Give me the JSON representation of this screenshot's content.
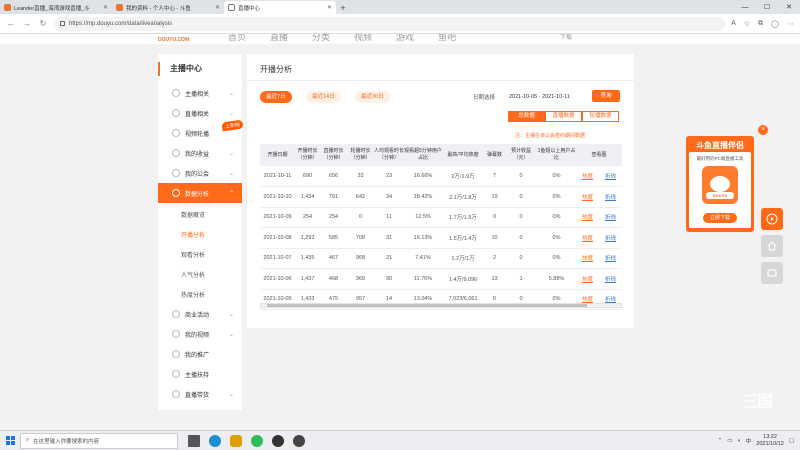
{
  "browser": {
    "tabs": [
      {
        "label": "Leander直播_海湾游戏直播_斗",
        "active": false
      },
      {
        "label": "我的资料 - 个人中心 - 斗鱼",
        "active": false
      },
      {
        "label": "直播中心",
        "active": true
      }
    ],
    "url": "https://mp.douyu.com/data/liveanalysis",
    "new_tab": "+",
    "win_min": "—",
    "win_max": "☐",
    "win_close": "✕"
  },
  "site": {
    "logo": "DOUYU.COM",
    "nav": [
      "首页",
      "直播",
      "分类",
      "视频",
      "游戏",
      "鱼吧"
    ],
    "user": "下载"
  },
  "sidebar": {
    "title": "主播中心",
    "items": [
      {
        "label": "主播相关",
        "chev": "⌄"
      },
      {
        "label": "直播相关",
        "chev": "⌄"
      },
      {
        "label": "视频轮播",
        "chev": ""
      },
      {
        "label": "我的收益",
        "chev": "⌄"
      },
      {
        "label": "我的公会",
        "chev": "⌄"
      },
      {
        "label": "数据分析",
        "chev": "⌃"
      }
    ],
    "sub_items": [
      "数据概览",
      "开播分析",
      "观看分析",
      "人气分析",
      "热度分析"
    ],
    "items_bottom": [
      {
        "label": "商业活动",
        "chev": "⌄"
      },
      {
        "label": "我的视频",
        "chev": "⌄"
      },
      {
        "label": "我的推广",
        "chev": ""
      },
      {
        "label": "主播扶持",
        "chev": ""
      },
      {
        "label": "直播带货",
        "chev": "⌄"
      }
    ],
    "new_badge": "上新啦"
  },
  "panel": {
    "title": "开播分析",
    "ranges": [
      "最近7日",
      "最近14日",
      "最近30日"
    ],
    "date_label": "日期选择",
    "date_value": "2021-10-05 - 2021-10-11",
    "query_button": "查询",
    "data_tabs": [
      "总数据",
      "直播数据",
      "轮播数据"
    ],
    "note": "注：主播在该公会签约期间数据",
    "table": {
      "headers": [
        "开播日期",
        "开播时长（分钟）",
        "直播时长（分钟）",
        "轮播时长（分钟）",
        "人均观看时长（分钟）",
        "观看超5分钟用户占比",
        "最高/平均热度",
        "弹幕数",
        "预计收益（元）",
        "1鱼翅以上用户占比",
        "查看图"
      ],
      "rows": [
        [
          "2021-10-11",
          "690",
          "656",
          "33",
          "23",
          "16.66%",
          "2万/1.9万",
          "7",
          "0",
          "0%",
          "热度",
          "折线"
        ],
        [
          "2021-10-10",
          "1,434",
          "791",
          "642",
          "34",
          "18.42%",
          "2.1万/1.8万",
          "19",
          "0",
          "0%",
          "热度",
          "折线"
        ],
        [
          "2021-10-09",
          "254",
          "254",
          "0",
          "11",
          "12.5%",
          "1.7万/1.5万",
          "0",
          "0",
          "0%",
          "热度",
          "折线"
        ],
        [
          "2021-10-08",
          "1,293",
          "585",
          "708",
          "31",
          "16.13%",
          "1.5万/1.4万",
          "10",
          "0",
          "0%",
          "热度",
          "折线"
        ],
        [
          "2021-10-07",
          "1,435",
          "467",
          "968",
          "21",
          "7.41%",
          "1.2万/1万",
          "2",
          "0",
          "0%",
          "热度",
          "折线"
        ],
        [
          "2021-10-06",
          "1,437",
          "468",
          "969",
          "30",
          "11.76%",
          "1.4万/9,096",
          "13",
          "1",
          "5.88%",
          "热度",
          "折线"
        ],
        [
          "2021-10-05",
          "1,433",
          "475",
          "957",
          "14",
          "13.04%",
          "7,023/6,061",
          "0",
          "0",
          "0%",
          "热度",
          "折线"
        ]
      ]
    }
  },
  "promo": {
    "title": "斗鱼直播伴侣",
    "subtitle": "最好用的PC端直播工具",
    "image_tag": "DOUYU",
    "button": "立即下载",
    "close": "×"
  },
  "watermark": "三国",
  "taskbar": {
    "search_placeholder": "在这里输入你要搜索的内容",
    "time": "13:22",
    "date": "2021/10/12"
  },
  "colors": {
    "accent": "#ff6a1a",
    "link_blue": "#3a7bd5"
  }
}
